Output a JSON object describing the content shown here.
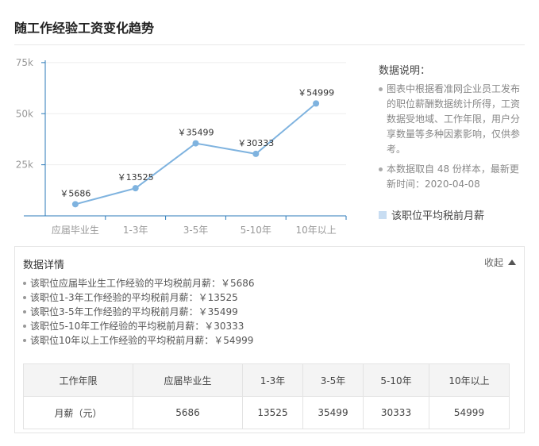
{
  "title": "随工作经验工资变化趋势",
  "sidebar": {
    "title": "数据说明：",
    "notes": [
      "图表中根据看准网企业员工发布的职位薪酬数据统计所得，工资数据受地域、工作年限，用户分享数量等多种因素影响，仅供参考。",
      "本数据取自 48 份样本，最新更新时间：2020-04-08"
    ],
    "legend": "该职位平均税前月薪"
  },
  "colors": {
    "line": "#7fb3df",
    "marker": "#7fb3df",
    "axis": "#2b7ab8",
    "legend_swatch": "#c8ddf2"
  },
  "chart_data": {
    "type": "line",
    "categories": [
      "应届毕业生",
      "1-3年",
      "3-5年",
      "5-10年",
      "10年以上"
    ],
    "series": [
      {
        "name": "该职位平均税前月薪",
        "values": [
          5686,
          13525,
          35499,
          30333,
          54999
        ]
      }
    ],
    "data_labels": [
      "￥5686",
      "￥13525",
      "￥35499",
      "￥30333",
      "￥54999"
    ],
    "yticks": [
      0,
      25000,
      50000,
      75000
    ],
    "ytick_labels": [
      "",
      "25k",
      "50k",
      "75k"
    ],
    "ylim": [
      0,
      80000
    ],
    "grid": true
  },
  "details": {
    "title": "数据详情",
    "collapse_label": "收起",
    "items": [
      "该职位应届毕业生工作经验的平均税前月薪：￥5686",
      "该职位1-3年工作经验的平均税前月薪：￥13525",
      "该职位3-5年工作经验的平均税前月薪：￥35499",
      "该职位5-10年工作经验的平均税前月薪：￥30333",
      "该职位10年以上工作经验的平均税前月薪：￥54999"
    ],
    "table": {
      "headers": [
        "工作年限",
        "应届毕业生",
        "1-3年",
        "3-5年",
        "5-10年",
        "10年以上"
      ],
      "row": [
        "月薪（元）",
        "5686",
        "13525",
        "35499",
        "30333",
        "54999"
      ]
    }
  }
}
